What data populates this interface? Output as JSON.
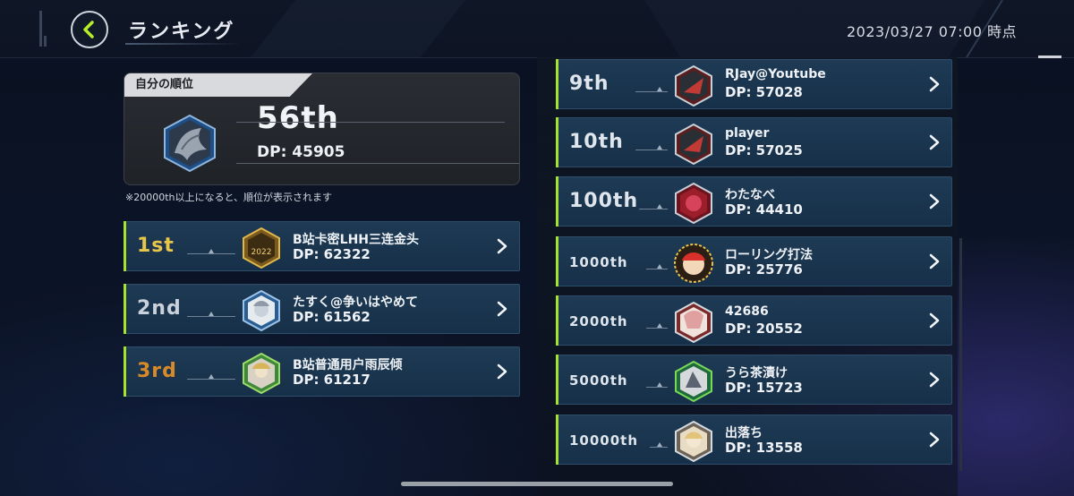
{
  "header": {
    "title": "ランキング",
    "timestamp": "2023/03/27 07:00 時点"
  },
  "my_rank": {
    "tab_label": "自分の順位",
    "rank": "56th",
    "dp": "DP: 45905",
    "note": "※20000th以上になると、順位が表示されます"
  },
  "top_rows": [
    {
      "rank": "1st",
      "name": "B站卡密LHH三连金头",
      "dp": "DP: 62322"
    },
    {
      "rank": "2nd",
      "name": "たすく@争いはやめて",
      "dp": "DP: 61562"
    },
    {
      "rank": "3rd",
      "name": "B站普通用户雨辰倾",
      "dp": "DP: 61217"
    }
  ],
  "right_rows": [
    {
      "rank": "9th",
      "name": "RJay@Youtube",
      "dp": "DP: 57028"
    },
    {
      "rank": "10th",
      "name": "player",
      "dp": "DP: 57025"
    },
    {
      "rank": "100th",
      "name": "わたなべ",
      "dp": "DP: 44410"
    },
    {
      "rank": "1000th",
      "name": "ローリング打法",
      "dp": "DP: 25776"
    },
    {
      "rank": "2000th",
      "name": "42686",
      "dp": "DP: 20552"
    },
    {
      "rank": "5000th",
      "name": "うら茶漬け",
      "dp": "DP: 15723"
    },
    {
      "rank": "10000th",
      "name": "出落ち",
      "dp": "DP: 13558"
    }
  ],
  "icons": {
    "back": "chevron-left-icon",
    "row_arrow": "chevron-right-icon"
  },
  "colors": {
    "accent_green": "#a6e22e",
    "gold": "#e8c64a",
    "silver": "#c9d1da",
    "bronze": "#d78a2a",
    "row_bg": "#1e3a54"
  }
}
